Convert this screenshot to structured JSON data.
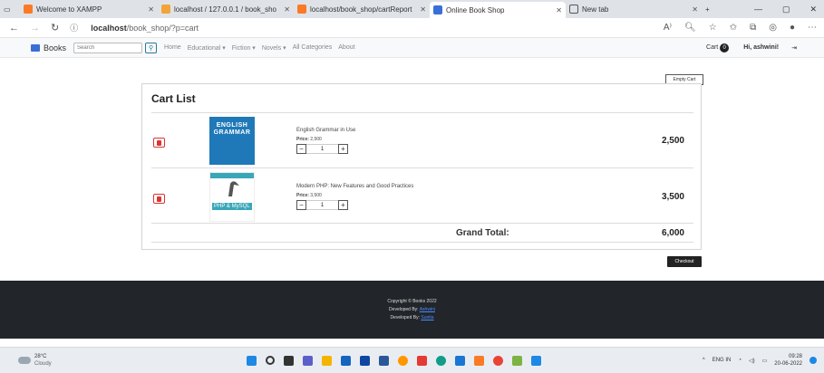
{
  "browser": {
    "tabs": [
      {
        "label": "Welcome to XAMPP",
        "color": "#fb7a24"
      },
      {
        "label": "localhost / 127.0.0.1 / book_sho",
        "color": "#f2a33a"
      },
      {
        "label": "localhost/book_shop/cartReport",
        "color": "#fb7a24"
      },
      {
        "label": "Online Book Shop",
        "color": "#3a6fd8"
      },
      {
        "label": "New tab",
        "color": "#555555"
      }
    ],
    "url_host": "localhost",
    "url_path": "/book_shop/?p=cart",
    "window_controls": [
      "—",
      "▢",
      "✕"
    ]
  },
  "site": {
    "brand": "Books",
    "search_placeholder": "Search",
    "menu": [
      "Home",
      "Educational ▾",
      "Fiction ▾",
      "Novels ▾",
      "All Categories",
      "About"
    ],
    "cart_label": "Cart",
    "cart_count": "0",
    "greeting": "Hi, ashwini!",
    "logout_icon": "⇥"
  },
  "cart": {
    "empty_label": "Empty Cart",
    "title": "Cart List",
    "items": [
      {
        "cover_title": "ENGLISH GRAMMAR",
        "name": "English Grammar in Use",
        "price_label": "Price:",
        "price": "2,500",
        "qty": "1",
        "total": "2,500"
      },
      {
        "cover_title": "PHP & MySQL",
        "name": "Modern PHP: New Features and Good Practices",
        "price_label": "Price:",
        "price": "3,500",
        "qty": "1",
        "total": "3,500"
      }
    ],
    "grand_total_label": "Grand Total:",
    "grand_total": "6,000",
    "checkout_label": "Checkout"
  },
  "footer": {
    "copyright": "Copyright © Books 2022",
    "dev1_label": "Developed By:",
    "dev1_name": "Ashwini",
    "dev2_label": "Developed By:",
    "dev2_name": "Sunita"
  },
  "taskbar": {
    "temp": "28°C",
    "weather": "Cloudy",
    "lang": "ENG IN",
    "time": "09:28",
    "date": "20-06-2022"
  }
}
